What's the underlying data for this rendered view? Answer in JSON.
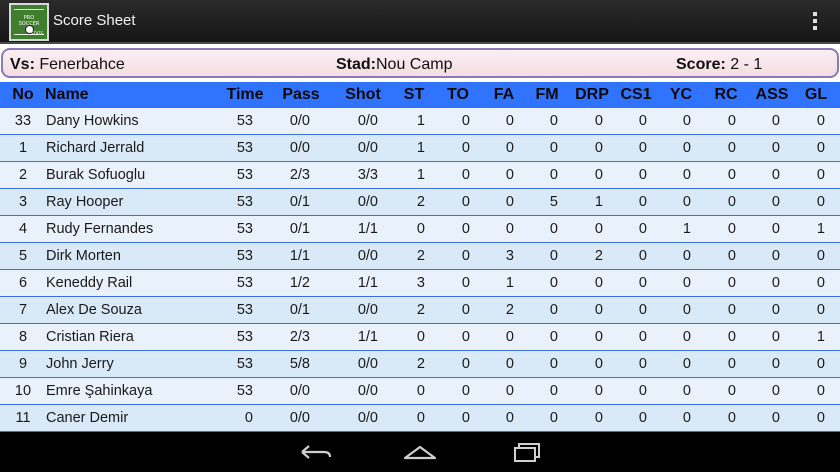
{
  "app": {
    "title": "Score Sheet",
    "icon_label": "PRO SOCCER",
    "icon_sub": "STATS"
  },
  "match": {
    "vs_label": "Vs:",
    "vs_value": "Fenerbahce",
    "stad_label": "Stad:",
    "stad_value": "Nou Camp",
    "score_label": "Score:",
    "score_value": "2 - 1"
  },
  "colors": {
    "header_bg": "#2f73ff",
    "row_light": "#e9f1fb",
    "row_dark": "#d9e9f8",
    "action_bar": "#1f1f1f",
    "info_border": "#8a7bb8"
  },
  "table": {
    "columns": [
      "No",
      "Name",
      "Time",
      "Pass",
      "Shot",
      "ST",
      "TO",
      "FA",
      "FM",
      "DRP",
      "CS1",
      "YC",
      "RC",
      "ASS",
      "GL"
    ],
    "rows": [
      [
        "33",
        "Dany Howkins",
        "53",
        "0/0",
        "0/0",
        "1",
        "0",
        "0",
        "0",
        "0",
        "0",
        "0",
        "0",
        "0",
        "0"
      ],
      [
        "1",
        "Richard Jerrald",
        "53",
        "0/0",
        "0/0",
        "1",
        "0",
        "0",
        "0",
        "0",
        "0",
        "0",
        "0",
        "0",
        "0"
      ],
      [
        "2",
        "Burak Sofuoglu",
        "53",
        "2/3",
        "3/3",
        "1",
        "0",
        "0",
        "0",
        "0",
        "0",
        "0",
        "0",
        "0",
        "0"
      ],
      [
        "3",
        "Ray Hooper",
        "53",
        "0/1",
        "0/0",
        "2",
        "0",
        "0",
        "5",
        "1",
        "0",
        "0",
        "0",
        "0",
        "0"
      ],
      [
        "4",
        "Rudy Fernandes",
        "53",
        "0/1",
        "1/1",
        "0",
        "0",
        "0",
        "0",
        "0",
        "0",
        "1",
        "0",
        "0",
        "1"
      ],
      [
        "5",
        "Dirk Morten",
        "53",
        "1/1",
        "0/0",
        "2",
        "0",
        "3",
        "0",
        "2",
        "0",
        "0",
        "0",
        "0",
        "0"
      ],
      [
        "6",
        "Keneddy Rail",
        "53",
        "1/2",
        "1/1",
        "3",
        "0",
        "1",
        "0",
        "0",
        "0",
        "0",
        "0",
        "0",
        "0"
      ],
      [
        "7",
        "Alex De Souza",
        "53",
        "0/1",
        "0/0",
        "2",
        "0",
        "2",
        "0",
        "0",
        "0",
        "0",
        "0",
        "0",
        "0"
      ],
      [
        "8",
        "Cristian Riera",
        "53",
        "2/3",
        "1/1",
        "0",
        "0",
        "0",
        "0",
        "0",
        "0",
        "0",
        "0",
        "0",
        "1"
      ],
      [
        "9",
        "John Jerry",
        "53",
        "5/8",
        "0/0",
        "2",
        "0",
        "0",
        "0",
        "0",
        "0",
        "0",
        "0",
        "0",
        "0"
      ],
      [
        "10",
        "Emre Şahinkaya",
        "53",
        "0/0",
        "0/0",
        "0",
        "0",
        "0",
        "0",
        "0",
        "0",
        "0",
        "0",
        "0",
        "0"
      ],
      [
        "11",
        "Caner Demir",
        "0",
        "0/0",
        "0/0",
        "0",
        "0",
        "0",
        "0",
        "0",
        "0",
        "0",
        "0",
        "0",
        "0"
      ]
    ]
  },
  "navigation": {
    "back": "back-icon",
    "home": "home-icon",
    "recents": "recents-icon"
  }
}
